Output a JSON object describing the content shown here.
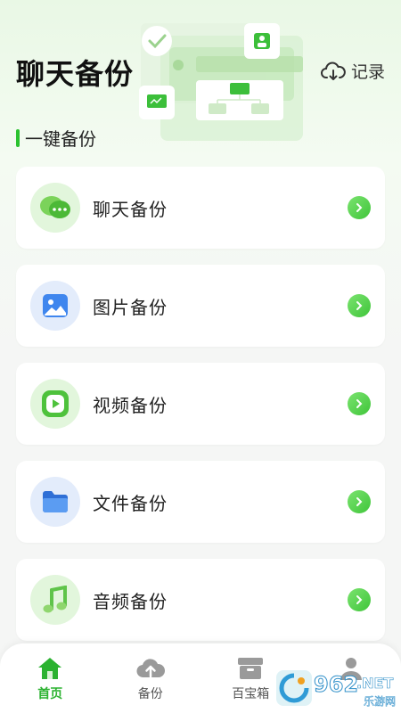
{
  "header": {
    "title": "聊天备份",
    "record_label": "记录"
  },
  "section": {
    "title": "一键备份"
  },
  "cards": [
    {
      "label": "聊天备份",
      "icon": "chat-bubbles-icon"
    },
    {
      "label": "图片备份",
      "icon": "image-icon"
    },
    {
      "label": "视频备份",
      "icon": "video-play-icon"
    },
    {
      "label": "文件备份",
      "icon": "folder-icon"
    },
    {
      "label": "音频备份",
      "icon": "music-note-icon"
    }
  ],
  "tabbar": [
    {
      "label": "首页",
      "icon": "home-icon",
      "active": true
    },
    {
      "label": "备份",
      "icon": "cloud-upload-icon",
      "active": false
    },
    {
      "label": "百宝箱",
      "icon": "box-icon",
      "active": false
    },
    {
      "label": "",
      "icon": "user-icon",
      "active": false
    }
  ],
  "watermark": {
    "text_top": "962",
    "text_net": ".NET",
    "text_bottom": "乐游网"
  },
  "colors": {
    "accent": "#2bc230",
    "tab_active": "#2bb230"
  }
}
